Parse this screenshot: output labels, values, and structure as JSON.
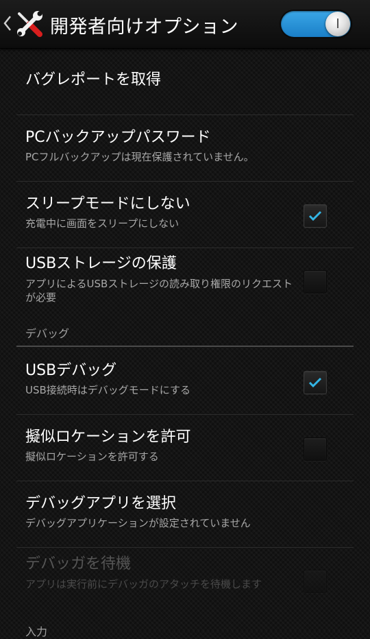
{
  "action_bar": {
    "title": "開発者向けオプション",
    "master_switch_on": true
  },
  "colors": {
    "accent": "#33b5e5",
    "switch_on": "#1a7fc8"
  },
  "items": [
    {
      "title": "バグレポートを取得",
      "summary": ""
    },
    {
      "title": "PCバックアップパスワード",
      "summary": "PCフルバックアップは現在保護されていません。"
    },
    {
      "title": "スリープモードにしない",
      "summary": "充電中に画面をスリープにしない",
      "checked": true
    },
    {
      "title": "USBストレージの保護",
      "summary": "アプリによるUSBストレージの読み取り権限のリクエストが必要",
      "checked": false
    },
    {
      "title": "USBデバッグ",
      "summary": "USB接続時はデバッグモードにする",
      "checked": true
    },
    {
      "title": "擬似ロケーションを許可",
      "summary": "擬似ロケーションを許可する",
      "checked": false
    },
    {
      "title": "デバッグアプリを選択",
      "summary": "デバッグアプリケーションが設定されていません"
    },
    {
      "title": "デバッガを待機",
      "summary": "アプリは実行前にデバッガのアタッチを待機します",
      "checked": false,
      "enabled": false
    }
  ],
  "categories": {
    "debug": "デバッグ",
    "input": "入力"
  }
}
